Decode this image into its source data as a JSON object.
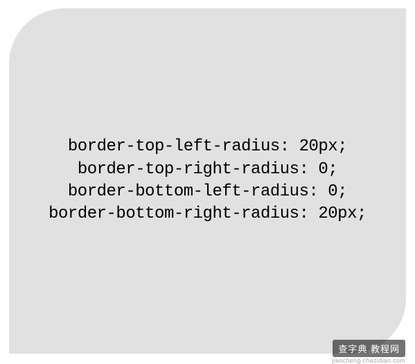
{
  "code": {
    "line1": "border-top-left-radius: 20px;",
    "line2": "border-top-right-radius: 0;",
    "line3": "border-bottom-left-radius: 0;",
    "line4": "border-bottom-right-radius: 20px;"
  },
  "watermark": {
    "main": "查字典 教程网",
    "sub": "jiaocheng.chazidian.com"
  }
}
